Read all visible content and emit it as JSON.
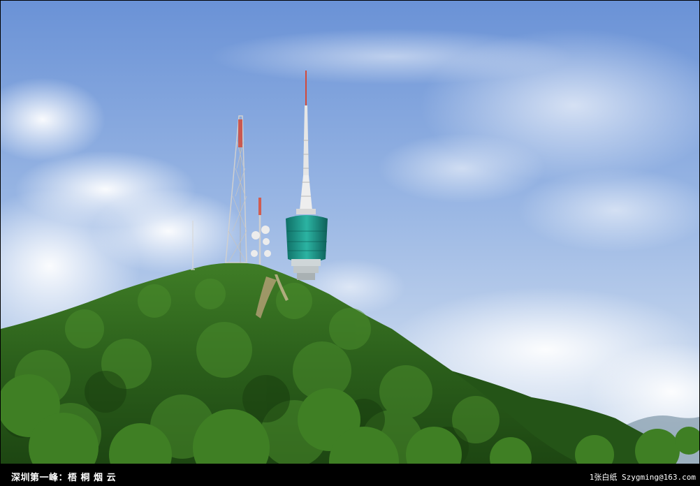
{
  "caption": {
    "title": "深圳第一峰：梧 桐 烟 云",
    "credit": "1张白纸 Szygming@163.com"
  },
  "scene": {
    "description_icons": [
      "sky",
      "clouds",
      "mountain",
      "tv-tower-icon",
      "lattice-mast-icon",
      "antenna-mast-icon"
    ],
    "colors": {
      "sky_top": "#6f96d8",
      "sky_bottom": "#dfe8f3",
      "forest": "#2f6a1f",
      "tower_pod": "#1f9c8e"
    }
  }
}
